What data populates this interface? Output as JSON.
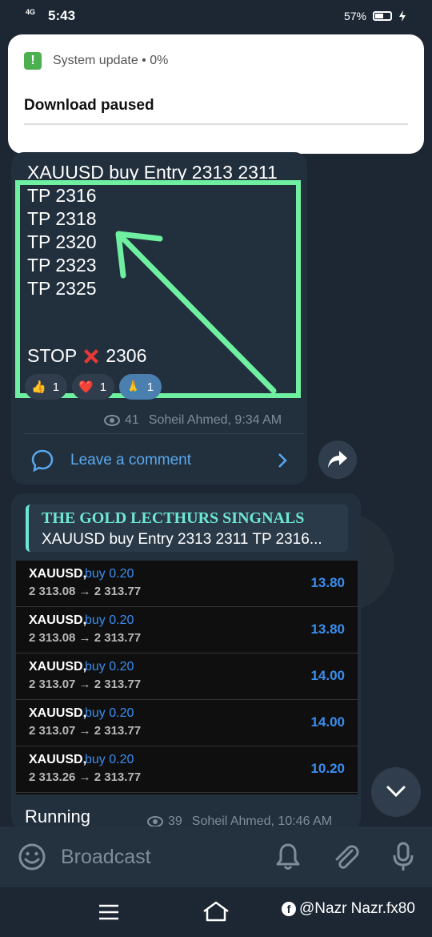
{
  "status_bar": {
    "network": "4G",
    "time": "5:43",
    "battery": "57%",
    "battery_level": 0.57
  },
  "notification": {
    "app_line": "System update • 0%",
    "title": "Download paused"
  },
  "message1": {
    "lines": [
      "XAUUSD buy Entry 2313 2311",
      "TP 2316",
      "TP 2318",
      "TP 2320",
      "TP 2323",
      "TP 2325"
    ],
    "stop_prefix": "STOP",
    "stop_value": "2306",
    "reactions": [
      {
        "emoji": "👍",
        "count": "1"
      },
      {
        "emoji": "❤️",
        "count": "1"
      },
      {
        "emoji": "🙏",
        "count": "1"
      }
    ],
    "views": "41",
    "author_time": "Soheil Ahmed, 9:34 AM",
    "comment_label": "Leave a comment"
  },
  "message2": {
    "reply_name": "THE GOLD LECTHURS SINGNALS",
    "reply_text": "XAUUSD buy Entry 2313 2311 TP 2316...",
    "trades": [
      {
        "symbol": "XAUUSD,",
        "side": "buy 0.20",
        "prices": "2 313.08 → 2 313.77",
        "profit": "13.80"
      },
      {
        "symbol": "XAUUSD,",
        "side": "buy 0.20",
        "prices": "2 313.08 → 2 313.77",
        "profit": "13.80"
      },
      {
        "symbol": "XAUUSD,",
        "side": "buy 0.20",
        "prices": "2 313.07 → 2 313.77",
        "profit": "14.00"
      },
      {
        "symbol": "XAUUSD,",
        "side": "buy 0.20",
        "prices": "2 313.07 → 2 313.77",
        "profit": "14.00"
      },
      {
        "symbol": "XAUUSD,",
        "side": "buy 0.20",
        "prices": "2 313.26 → 2 313.77",
        "profit": "10.20"
      }
    ],
    "caption": "Running",
    "views": "39",
    "author_time": "Soheil Ahmed, 10:46 AM"
  },
  "input": {
    "placeholder": "Broadcast"
  },
  "watermark": "@Nazr Nazr.fx80",
  "colors": {
    "highlight": "#6ff0a0",
    "link": "#5aa8ec",
    "profit": "#3a8ef0",
    "reply_accent": "#6ee7d6"
  }
}
